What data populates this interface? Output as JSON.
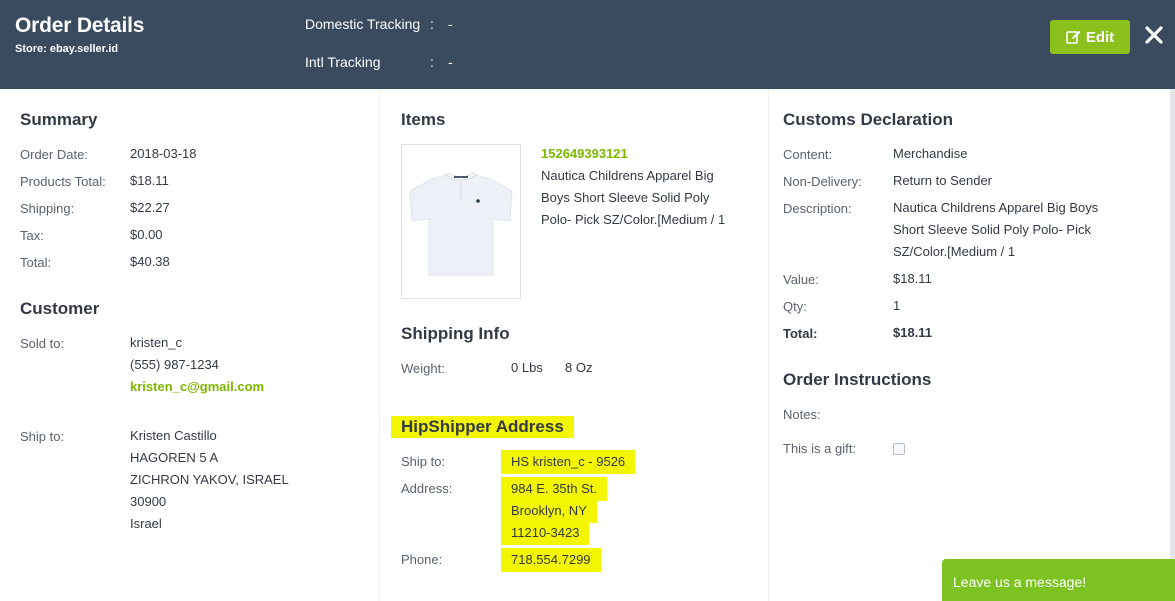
{
  "header": {
    "title": "Order Details",
    "store_label": "Store:",
    "store_value": "ebay.seller.id",
    "domestic_tracking_label": "Domestic Tracking",
    "domestic_tracking_value": "-",
    "intl_tracking_label": "Intl Tracking",
    "intl_tracking_value": "-",
    "colon": ":",
    "edit_label": "Edit",
    "colors": {
      "background": "#3a4a5f",
      "edit_button": "#8cc01c"
    }
  },
  "summary": {
    "title": "Summary",
    "rows": [
      {
        "label": "Order Date:",
        "value": "2018-03-18"
      },
      {
        "label": "Products Total:",
        "value": "$18.11"
      },
      {
        "label": "Shipping:",
        "value": "$22.27"
      },
      {
        "label": "Tax:",
        "value": "$0.00"
      },
      {
        "label": "Total:",
        "value": "$40.38"
      }
    ]
  },
  "customer": {
    "title": "Customer",
    "sold_to_label": "Sold to:",
    "sold_to": {
      "username": "kristen_c",
      "phone": "(555) 987-1234",
      "email": "kristen_c@gmail.com"
    },
    "ship_to_label": "Ship to:",
    "ship_to": [
      "Kristen Castillo",
      "HAGOREN 5 A",
      "ZICHRON YAKOV, ISRAEL",
      "30900",
      "Israel"
    ]
  },
  "items": {
    "title": "Items",
    "item_id": "152649393121",
    "description_lines": [
      "Nautica Childrens Apparel Big",
      "Boys Short Sleeve Solid Poly",
      "Polo- Pick SZ/Color.[Medium / 1"
    ]
  },
  "shipping_info": {
    "title": "Shipping Info",
    "weight_label": "Weight:",
    "lbs": "0 Lbs",
    "oz": "8 Oz"
  },
  "hipshipper": {
    "title": "HipShipper Address",
    "ship_to_label": "Ship to:",
    "ship_to": "HS kristen_c - 9526",
    "address_label": "Address:",
    "address_lines": [
      "984 E. 35th St.",
      "Brooklyn, NY",
      "11210-3423"
    ],
    "phone_label": "Phone:",
    "phone": "718.554.7299",
    "highlight_color": "#f4f500"
  },
  "customs": {
    "title": "Customs Declaration",
    "content_label": "Content:",
    "content": "Merchandise",
    "non_delivery_label": "Non-Delivery:",
    "non_delivery": "Return to Sender",
    "description_label": "Description:",
    "description_lines": [
      "Nautica Childrens Apparel Big Boys",
      "Short Sleeve Solid Poly Polo- Pick",
      "SZ/Color.[Medium / 1"
    ],
    "value_label": "Value:",
    "value": "$18.11",
    "qty_label": "Qty:",
    "qty": "1",
    "total_label": "Total:",
    "total": "$18.11"
  },
  "order_instructions": {
    "title": "Order Instructions",
    "notes_label": "Notes:",
    "gift_label": "This is a gift:",
    "gift_checked": false
  },
  "chat": {
    "label": "Leave us a message!",
    "color": "#7cc321"
  }
}
